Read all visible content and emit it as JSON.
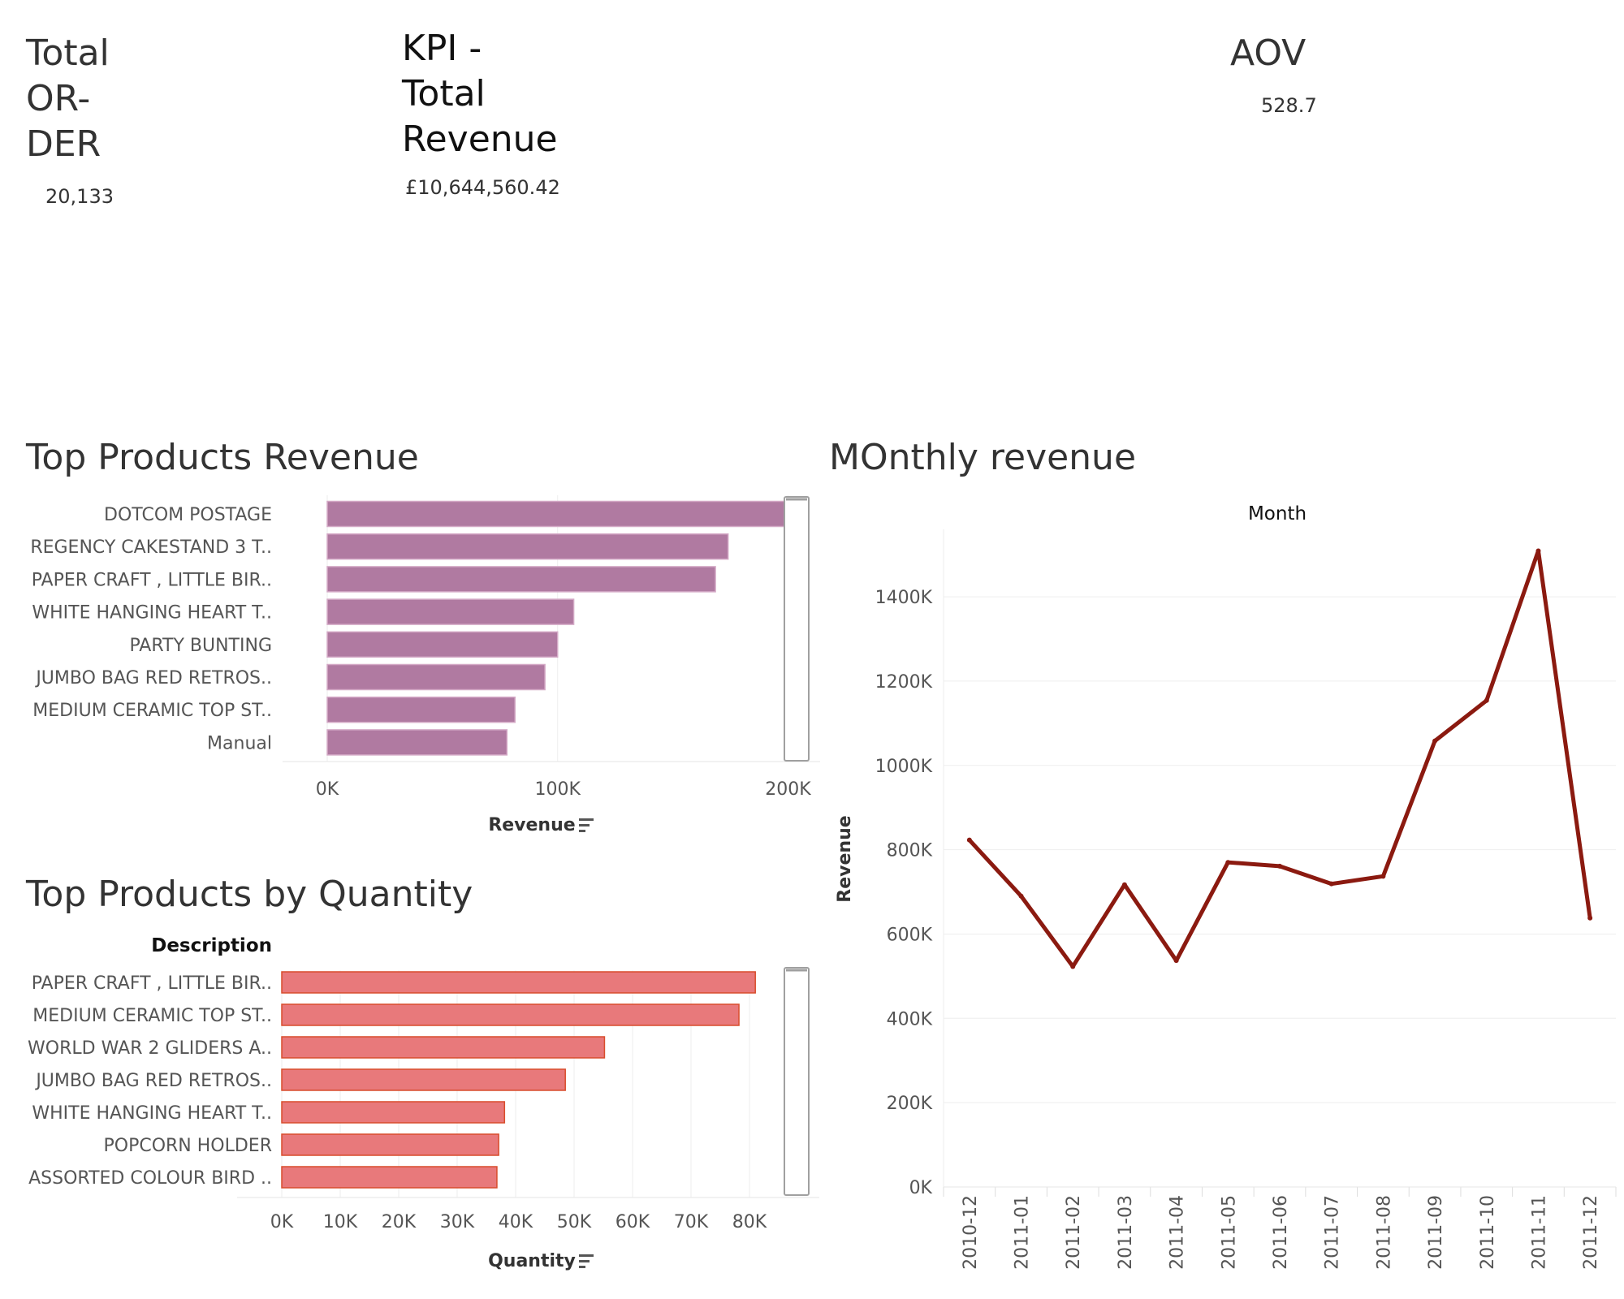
{
  "kpis": {
    "total_order": {
      "title": "Total\nOR-\nDER",
      "value": "20,133"
    },
    "total_revenue": {
      "title": "KPI -\nTotal\nRevenue",
      "value": "£10,644,560.42"
    },
    "aov": {
      "title": "AOV",
      "value": "528.7"
    }
  },
  "colors": {
    "revenue_bar": "#b07aa1",
    "revenue_bar_border": "#d4a9c6",
    "quantity_bar": "#e8797b",
    "quantity_bar_border": "#d94c2c",
    "line": "#8b1a10",
    "grid": "#eeeeee",
    "label": "#555555"
  },
  "chart_data": [
    {
      "type": "bar",
      "orientation": "horizontal",
      "title": "Top Products Revenue",
      "categories": [
        "DOTCOM POSTAGE",
        "REGENCY CAKESTAND 3 T..",
        "PAPER CRAFT , LITTLE BIR..",
        "WHITE HANGING HEART T..",
        "PARTY BUNTING",
        "JUMBO BAG RED RETROS..",
        "MEDIUM CERAMIC TOP ST..",
        "Manual"
      ],
      "values": [
        206000,
        174000,
        168500,
        107000,
        100000,
        94500,
        81500,
        78000
      ],
      "xlabel": "Revenue",
      "xlim": [
        0,
        215000
      ],
      "ticks": [
        0,
        100000,
        200000
      ],
      "tick_labels": [
        "0K",
        "100K",
        "200K"
      ],
      "sort_icon": "sort-descending-icon"
    },
    {
      "type": "bar",
      "orientation": "horizontal",
      "title": "Top Products by Quantity",
      "category_header": "Description",
      "categories": [
        "PAPER CRAFT , LITTLE BIR..",
        "MEDIUM CERAMIC TOP ST..",
        "WORLD WAR 2 GLIDERS A..",
        "JUMBO BAG RED RETROS..",
        "WHITE HANGING HEART T..",
        "POPCORN HOLDER",
        "ASSORTED COLOUR BIRD .."
      ],
      "values": [
        81000,
        78200,
        55200,
        48500,
        38100,
        37100,
        36800
      ],
      "xlabel": "Quantity",
      "xlim": [
        0,
        85000
      ],
      "ticks": [
        0,
        10000,
        20000,
        30000,
        40000,
        50000,
        60000,
        70000,
        80000
      ],
      "tick_labels": [
        "0K",
        "10K",
        "20K",
        "30K",
        "40K",
        "50K",
        "60K",
        "70K",
        "80K"
      ],
      "sort_icon": "sort-descending-icon"
    },
    {
      "type": "line",
      "title": "MOnthly revenue",
      "column_header": "Month",
      "categories": [
        "2010-12",
        "2011-01",
        "2011-02",
        "2011-03",
        "2011-04",
        "2011-05",
        "2011-06",
        "2011-07",
        "2011-08",
        "2011-09",
        "2011-10",
        "2011-11",
        "2011-12"
      ],
      "values": [
        823000,
        690000,
        523000,
        717000,
        537000,
        770000,
        761000,
        719000,
        737000,
        1058000,
        1154000,
        1509000,
        638000
      ],
      "ylabel": "Revenue",
      "ylim": [
        0,
        1560000
      ],
      "ticks": [
        0,
        200000,
        400000,
        600000,
        800000,
        1000000,
        1200000,
        1400000
      ],
      "tick_labels": [
        "0K",
        "200K",
        "400K",
        "600K",
        "800K",
        "1000K",
        "1200K",
        "1400K"
      ],
      "grid": true
    }
  ]
}
